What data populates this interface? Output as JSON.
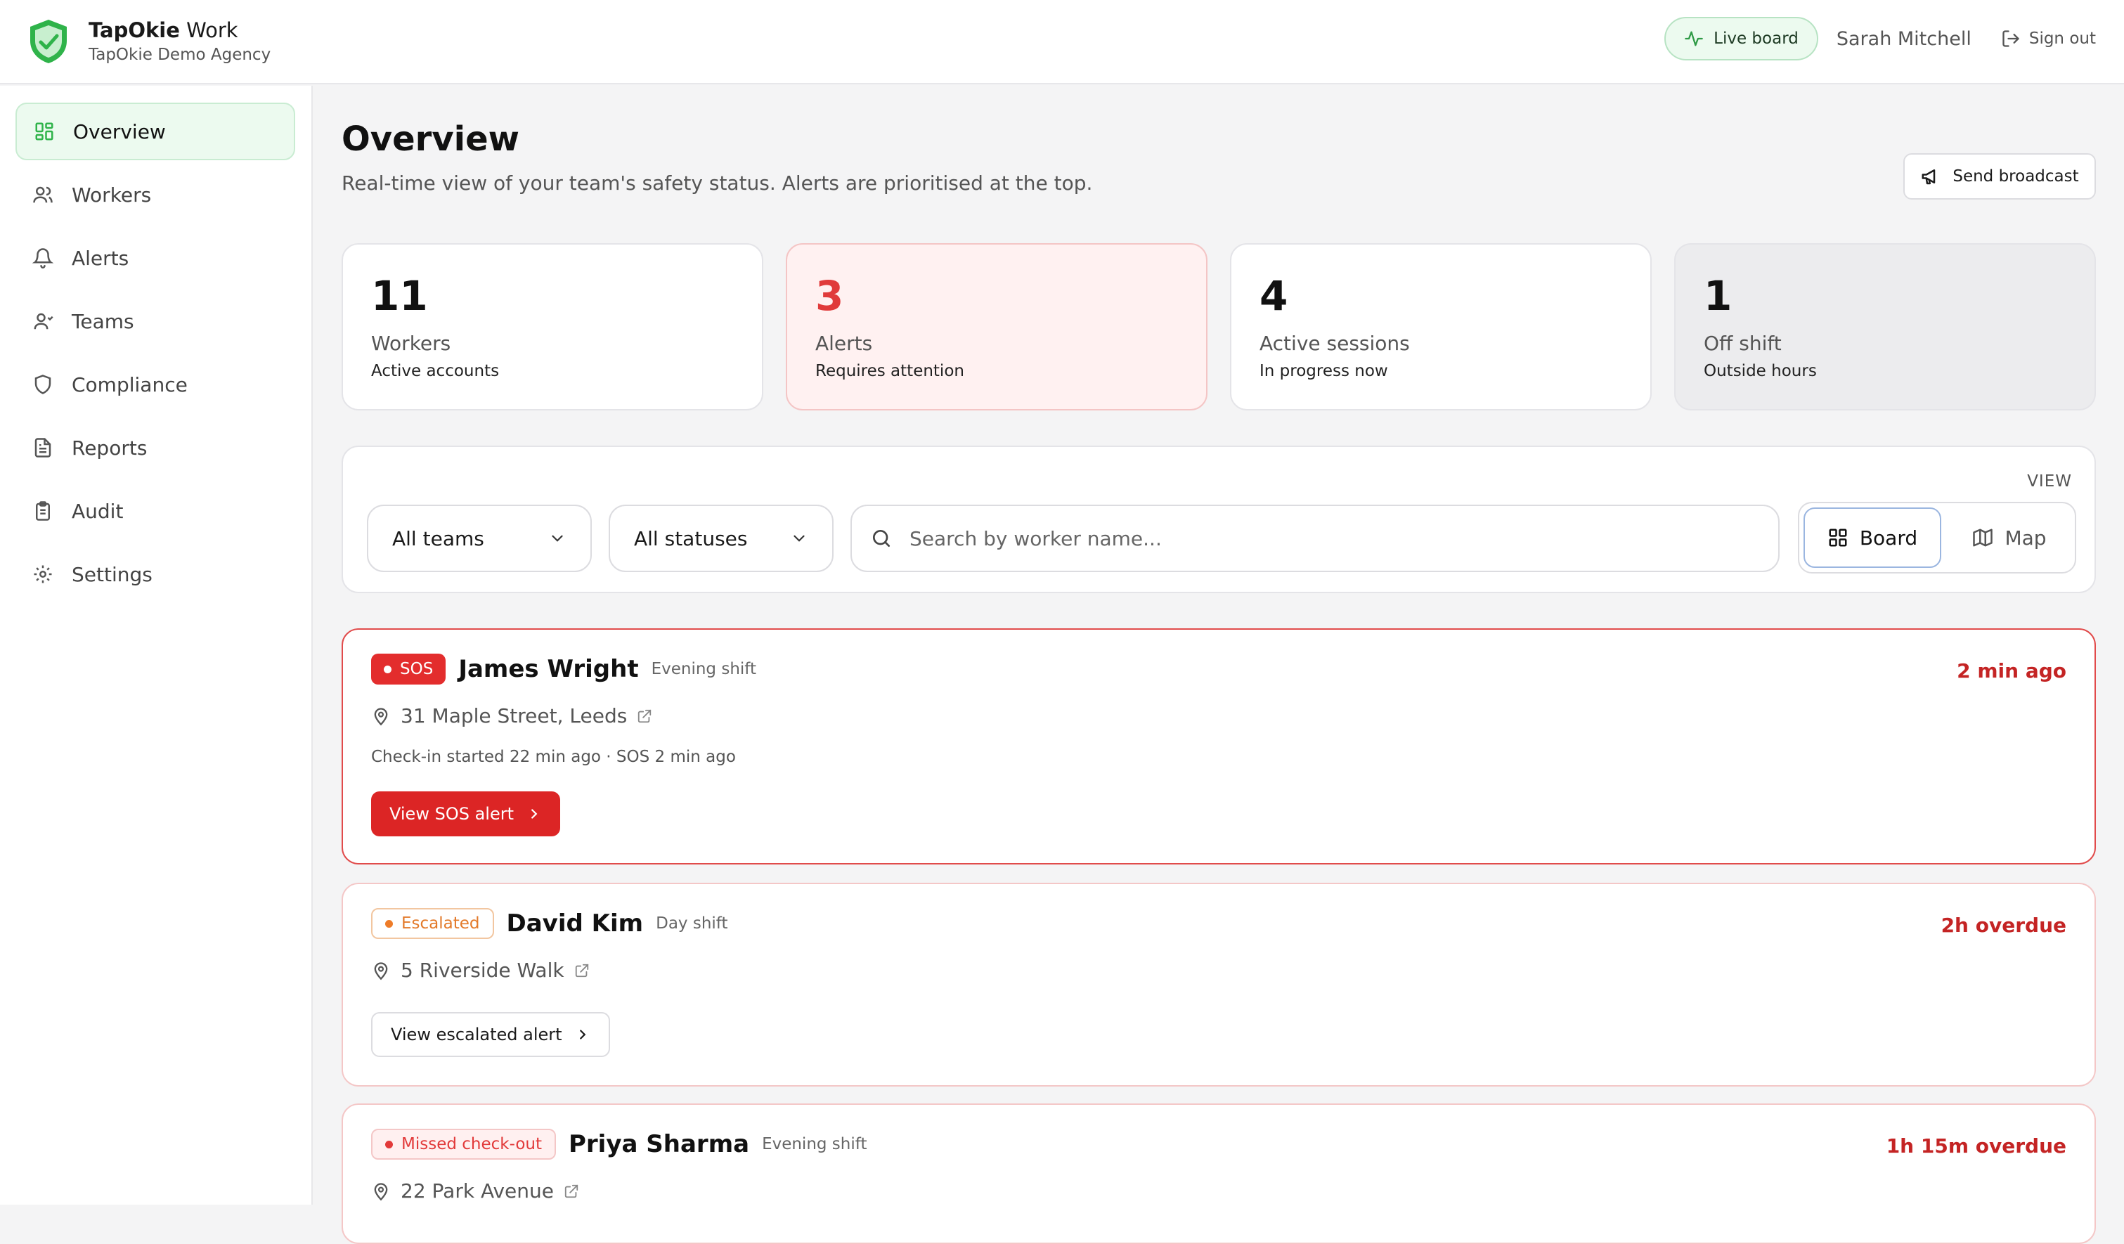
{
  "brand": {
    "name_bold": "TapOkie",
    "name_rest": " Work",
    "agency": "TapOkie Demo Agency",
    "logo_icon": "shield-check-icon",
    "logo_color": "#2fb34a"
  },
  "header": {
    "live_board": "Live board",
    "user": "Sarah Mitchell",
    "sign_out": "Sign out"
  },
  "sidebar": {
    "items": [
      {
        "label": "Overview",
        "icon": "grid-icon",
        "active": true
      },
      {
        "label": "Workers",
        "icon": "users-icon"
      },
      {
        "label": "Alerts",
        "icon": "bell-icon"
      },
      {
        "label": "Teams",
        "icon": "team-icon"
      },
      {
        "label": "Compliance",
        "icon": "shield-icon"
      },
      {
        "label": "Reports",
        "icon": "document-icon"
      },
      {
        "label": "Audit",
        "icon": "clipboard-icon"
      },
      {
        "label": "Settings",
        "icon": "gear-icon"
      }
    ]
  },
  "page": {
    "title": "Overview",
    "description": "Real-time view of your team's safety status. Alerts are prioritised at the top.",
    "broadcast": "Send broadcast"
  },
  "stats": [
    {
      "value": "11",
      "label": "Workers",
      "hint": "Active accounts"
    },
    {
      "value": "3",
      "label": "Alerts",
      "hint": "Requires attention"
    },
    {
      "value": "4",
      "label": "Active sessions",
      "hint": "In progress now"
    },
    {
      "value": "1",
      "label": "Off shift",
      "hint": "Outside hours"
    }
  ],
  "filters": {
    "view_label": "VIEW",
    "team": "All teams",
    "status": "All statuses",
    "search_placeholder": "Search by worker name...",
    "view_board": "Board",
    "view_map": "Map"
  },
  "alerts": [
    {
      "badge": "SOS",
      "name": "James Wright",
      "shift": "Evening shift",
      "time": "2 min ago",
      "address": "31 Maple Street, Leeds",
      "meta": "Check-in started 22 min ago · SOS 2 min ago",
      "action": "View SOS alert"
    },
    {
      "badge": "Escalated",
      "name": "David Kim",
      "shift": "Day shift",
      "time": "2h overdue",
      "address": "5 Riverside Walk",
      "action": "View escalated alert"
    },
    {
      "badge": "Missed check-out",
      "name": "Priya Sharma",
      "shift": "Evening shift",
      "time": "1h 15m overdue",
      "address": "22 Park Avenue"
    }
  ],
  "colors": {
    "accent_green": "#2fb34a",
    "alert_red": "#dc2525",
    "escalated_orange": "#ee7c28"
  }
}
